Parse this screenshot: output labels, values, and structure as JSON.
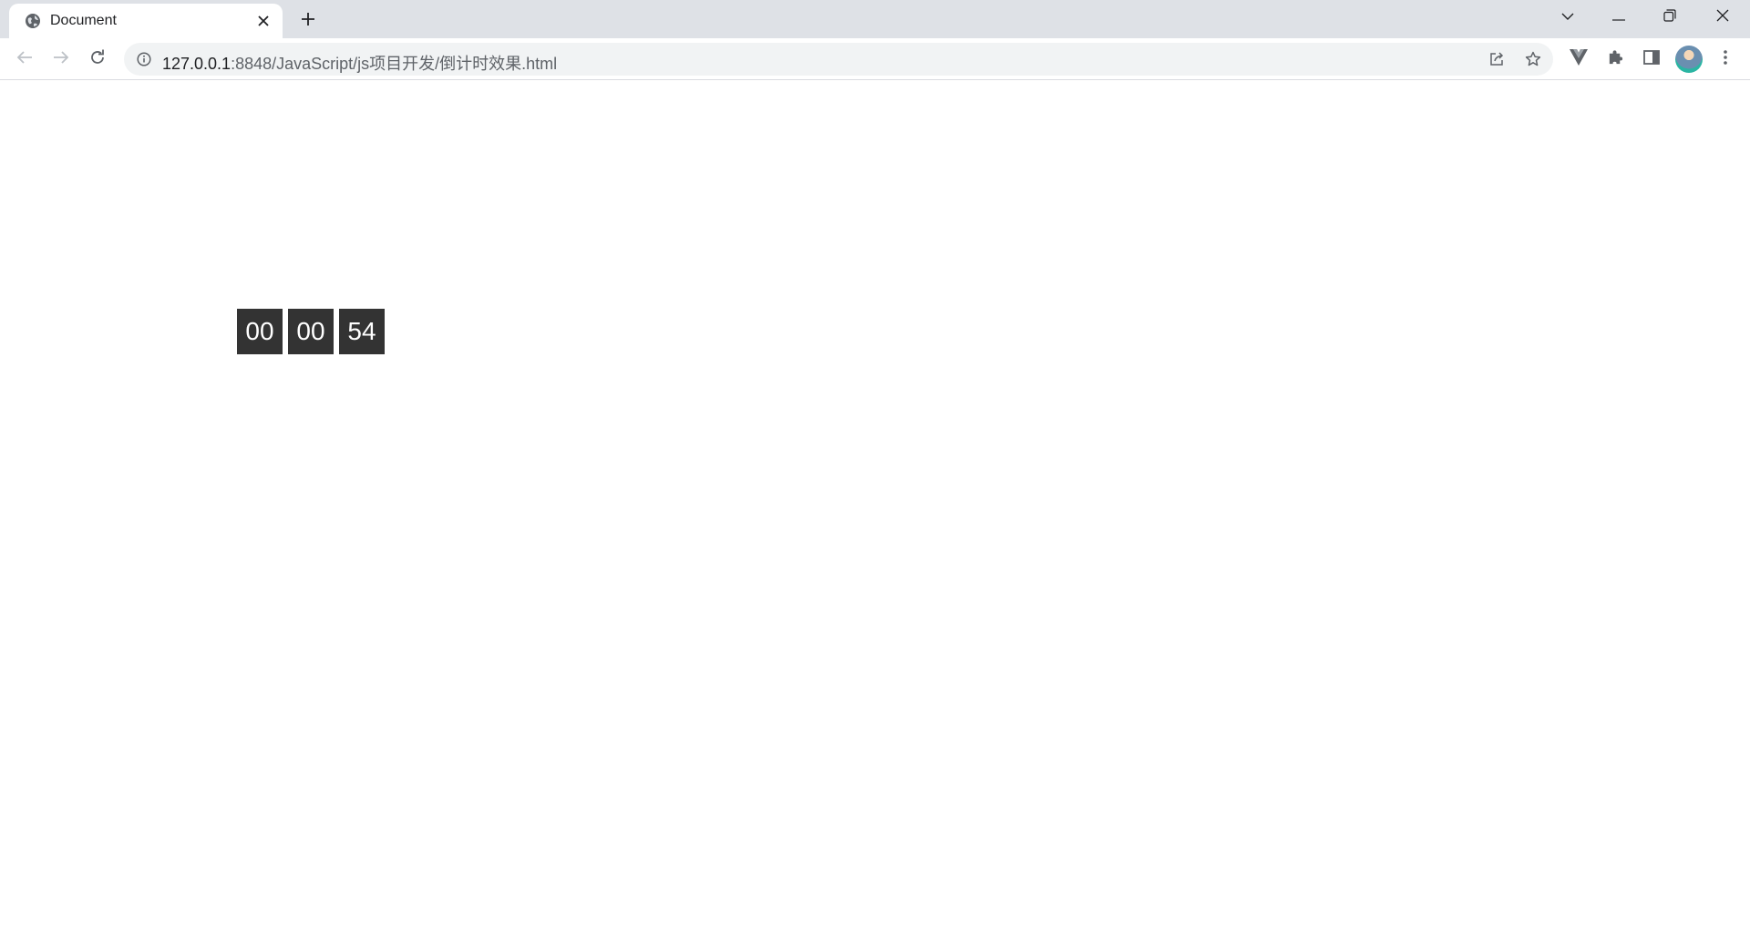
{
  "tab": {
    "title": "Document",
    "favicon_icon": "globe-icon",
    "close_icon": "close-icon"
  },
  "tabstrip": {
    "new_tab_icon": "plus-icon",
    "tab_search_icon": "chevron-down-icon"
  },
  "window_controls": [
    "minimize-icon",
    "restore-icon",
    "close-icon"
  ],
  "toolbar": {
    "back_icon": "back-arrow-icon",
    "forward_icon": "forward-arrow-icon",
    "reload_icon": "reload-icon"
  },
  "omnibox": {
    "info_icon": "info-icon",
    "url_host": "127.0.0.1",
    "url_rest": ":8848/JavaScript/js项目开发/倒计时效果.html",
    "share_icon": "share-icon",
    "bookmark_icon": "star-icon"
  },
  "extensions": [
    "vue-devtools-icon",
    "puzzle-icon",
    "side-panel-icon"
  ],
  "menu_icon": "kebab-menu-icon",
  "countdown": {
    "hours": "00",
    "minutes": "00",
    "seconds": "54"
  },
  "colors": {
    "tabstrip_bg": "#dee1e6",
    "omnibox_bg": "#f1f3f4",
    "countdown_bg": "#333333",
    "countdown_text": "#ffffff"
  }
}
